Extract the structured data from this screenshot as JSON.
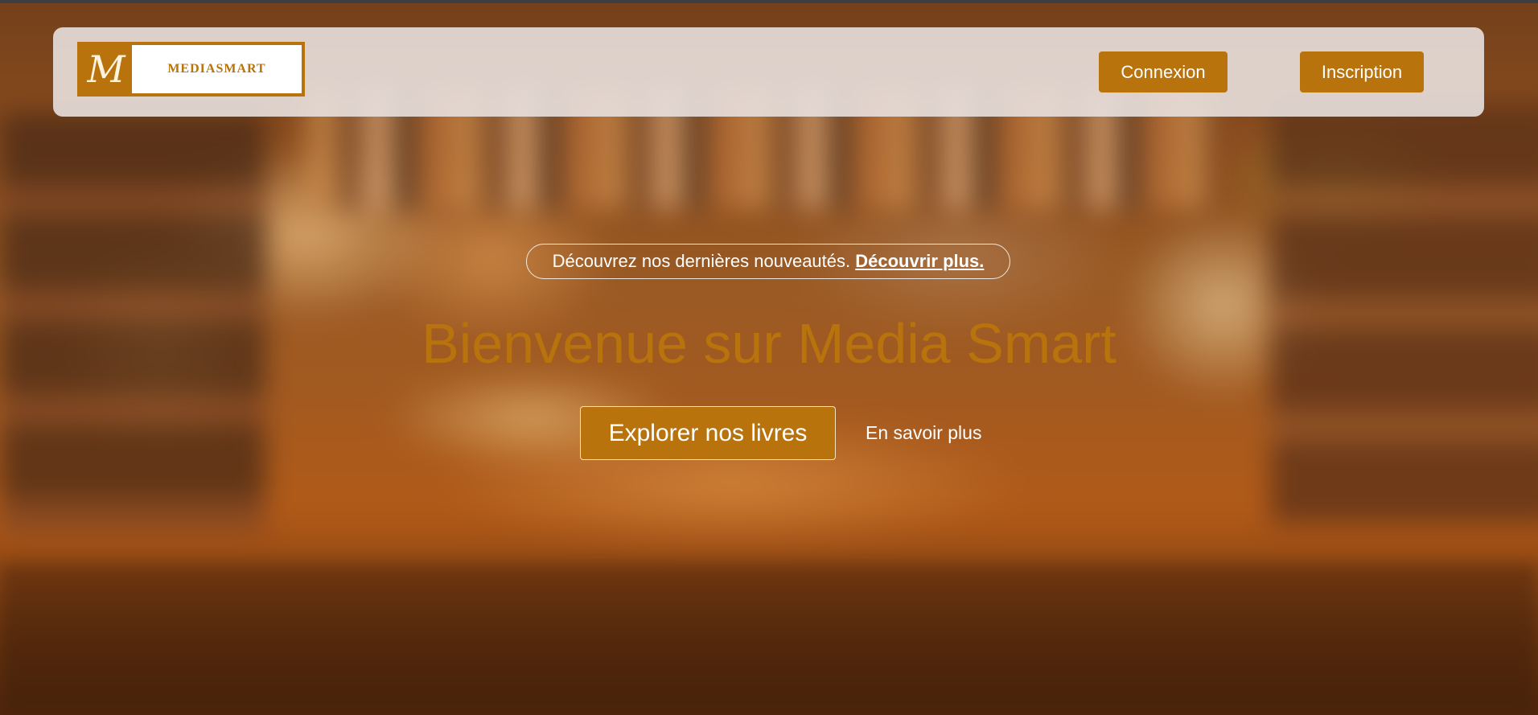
{
  "brand": {
    "logo_mark": "M",
    "logo_text": "MEDIASMART",
    "accent_color": "#b8730d"
  },
  "header": {
    "login_label": "Connexion",
    "signup_label": "Inscription"
  },
  "hero": {
    "announcement_text": "Découvrez nos dernières nouveautés.",
    "announcement_link": "Découvrir plus.",
    "title": "Bienvenue sur Media Smart",
    "primary_cta": "Explorer nos livres",
    "secondary_cta": "En savoir plus"
  },
  "background": {
    "description_icon": "blurred-library-sofa-image"
  }
}
